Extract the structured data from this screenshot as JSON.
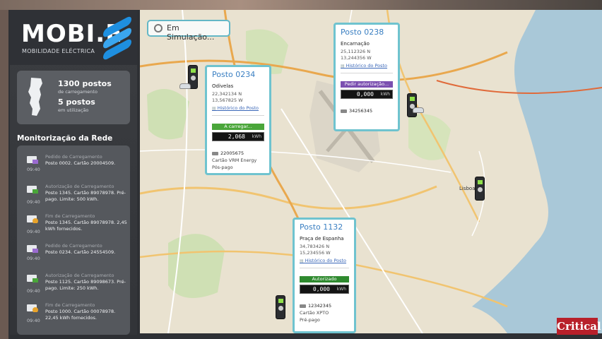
{
  "brand": {
    "name": "MOBI.E",
    "subtitle": "MOBILIDADE ELÉCTRICA",
    "logo_color": "#1e8fe0"
  },
  "stats": {
    "posts_count": "1300 postos",
    "posts_label": "de carregamento",
    "in_use_count": "5 postos",
    "in_use_label": "em utilização"
  },
  "monitor": {
    "title": "Monitorização da Rede",
    "items": [
      {
        "icon": "request-icon",
        "title": "Pedido de Carregamento",
        "detail": "Posto 0002. Cartão 20004509.",
        "time": "09:40"
      },
      {
        "icon": "authorization-icon",
        "title": "Autorização de Carregamento",
        "detail": "Posto 1345. Cartão 89078978. Pré-pago. Limite: 500 kWh.",
        "time": "09:40"
      },
      {
        "icon": "end-charge-icon",
        "title": "Fim de Carregamento",
        "detail": "Posto 1345. Cartão 89078978. 2,45 kWh fornecidos.",
        "time": "09:40"
      },
      {
        "icon": "request-icon",
        "title": "Pedido de Carregamento",
        "detail": "Posto 0234. Cartão 24554509.",
        "time": "09:40"
      },
      {
        "icon": "authorization-icon",
        "title": "Autorização de Carregamento",
        "detail": "Posto 1125. Cartão 89098673. Pré-pago. Limite: 250 kWh.",
        "time": "09:40"
      },
      {
        "icon": "end-charge-icon",
        "title": "Fim de Carregamento",
        "detail": "Posto 1000. Cartão 00078978. 22,45 kWh fornecidos.",
        "time": "09:40"
      }
    ]
  },
  "map": {
    "simulation_label": "Em Simulação...",
    "place_lisboa": "Lisboa",
    "colors": {
      "popup_border": "#6fc3cf",
      "charging": "#4aa63a",
      "authorization": "#7b4fb0",
      "authorized": "#2f8a2f"
    }
  },
  "popups": {
    "p0234": {
      "title": "Posto 0234",
      "place": "Odivelas",
      "lat": "22,342134 N",
      "lon": "13,567825 W",
      "history": "Histórico do Posto",
      "status": "A carregar...",
      "meter_value": "2,068",
      "meter_unit": "kWh",
      "card_number": "22005675",
      "card_type": "Cartão VRM Energy",
      "plan": "Pós-pago"
    },
    "p0238": {
      "title": "Posto 0238",
      "place": "Encarnação",
      "lat": "25,112326 N",
      "lon": "13,244356 W",
      "history": "Histórico do Posto",
      "status": "Pedir autorização...",
      "meter_value": "0,000",
      "meter_unit": "kWh",
      "card_number": "34256345"
    },
    "p1132": {
      "title": "Posto 1132",
      "place": "Praça de Espanha",
      "lat": "34,783426 N",
      "lon": "15,234556 W",
      "history": "Histórico do Posto",
      "status": "Autorizado",
      "meter_value": "0,000",
      "meter_unit": "kWh",
      "card_number": "12342345",
      "card_type": "Cartão XPTO",
      "plan": "Pré-pago"
    }
  },
  "footer": {
    "critical_logo": "Critical"
  }
}
